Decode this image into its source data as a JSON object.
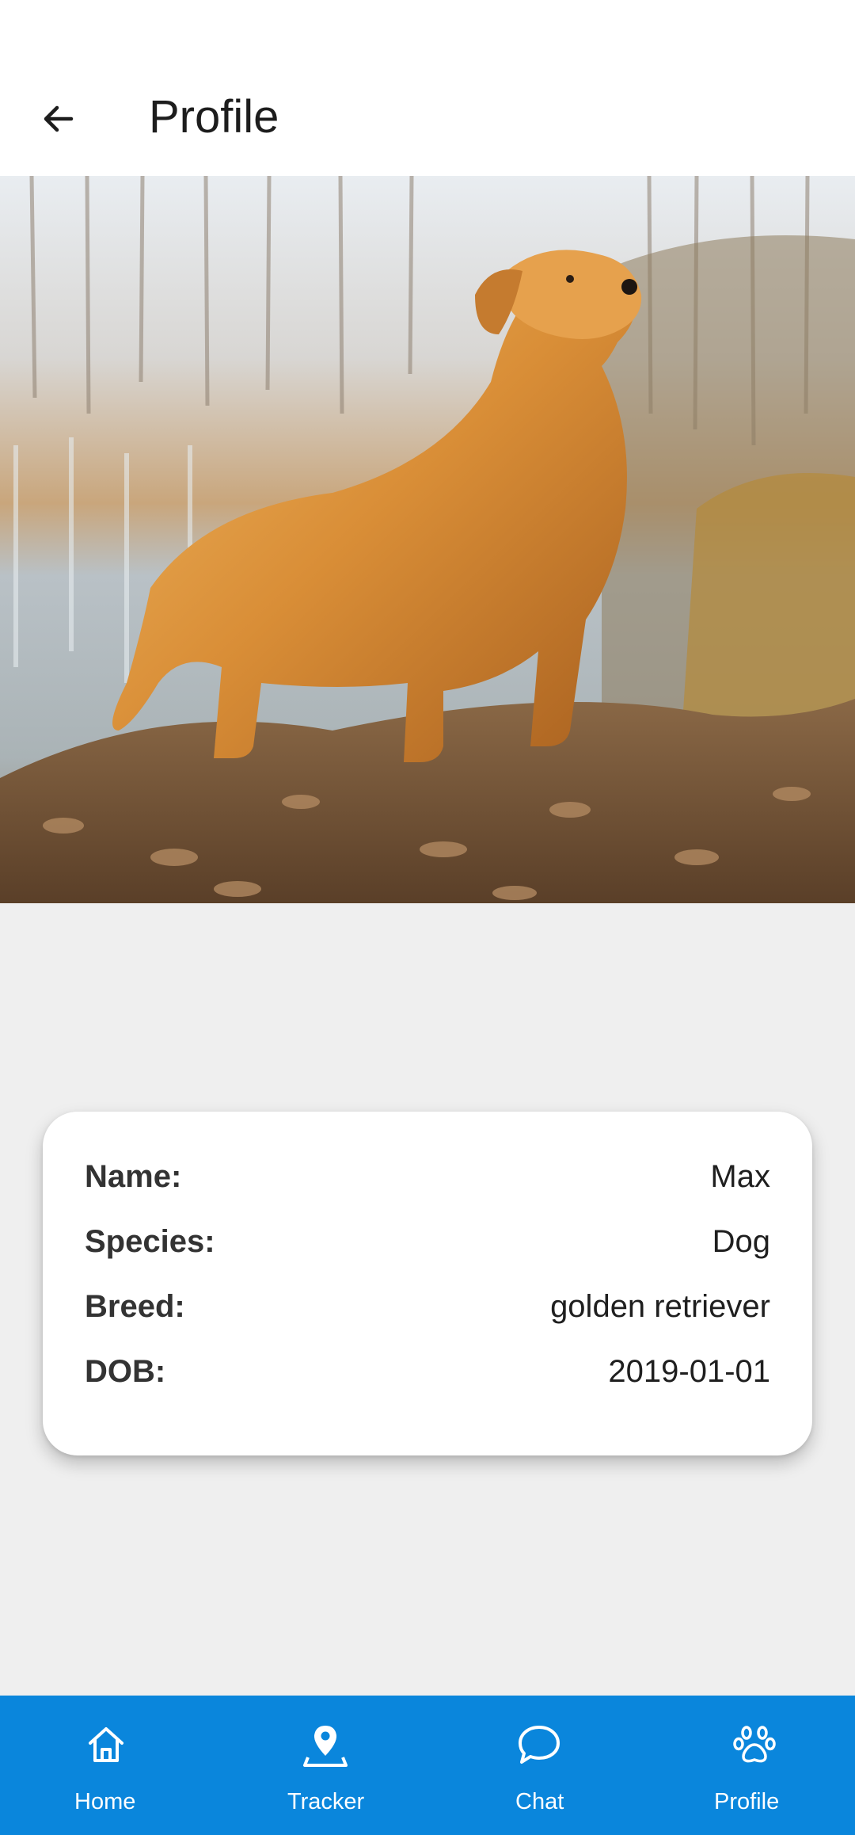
{
  "header": {
    "title": "Profile",
    "back_icon": "arrow-left-icon"
  },
  "hero": {
    "subject": "golden retriever standing on dry leaves by a lake"
  },
  "profile": {
    "rows": [
      {
        "label": "Name:",
        "value": "Max"
      },
      {
        "label": "Species:",
        "value": "Dog"
      },
      {
        "label": "Breed:",
        "value": "golden retriever"
      },
      {
        "label": "DOB:",
        "value": "2019-01-01"
      }
    ]
  },
  "bottom_nav": {
    "background": "#0a86dc",
    "items": [
      {
        "label": "Home",
        "icon": "home-icon"
      },
      {
        "label": "Tracker",
        "icon": "map-pin-icon"
      },
      {
        "label": "Chat",
        "icon": "chat-bubble-icon"
      },
      {
        "label": "Profile",
        "icon": "paw-icon"
      }
    ]
  }
}
